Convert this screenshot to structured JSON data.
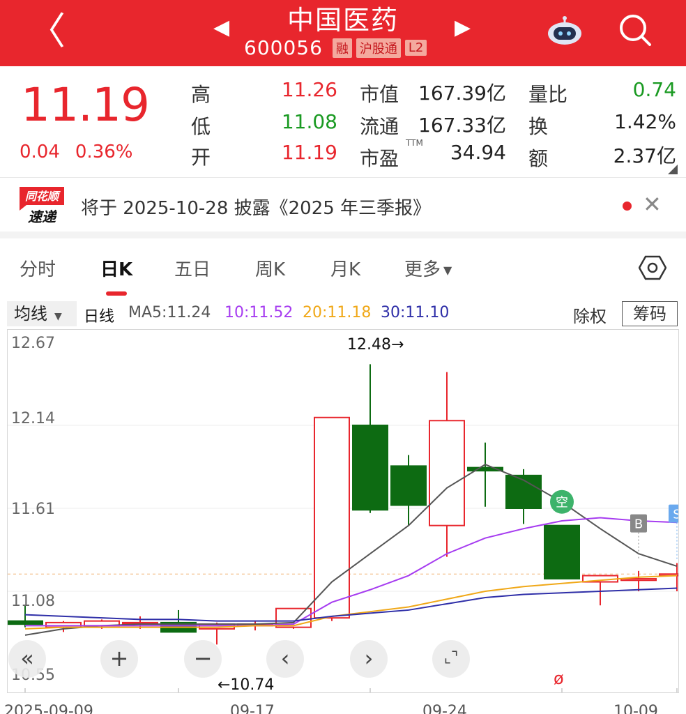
{
  "header": {
    "stock_name": "中国医药",
    "stock_code": "600056",
    "tags": [
      "融",
      "沪股通",
      "L2"
    ]
  },
  "quote": {
    "price": "11.19",
    "change": "0.04",
    "change_pct": "0.36%",
    "high_label": "高",
    "high": "11.26",
    "low_label": "低",
    "low": "11.08",
    "open_label": "开",
    "open": "11.19",
    "mktcap_label": "市值",
    "mktcap": "167.39亿",
    "float_label": "流通",
    "float": "167.33亿",
    "pe_label": "市盈",
    "pe_sup": "TTM",
    "pe": "34.94",
    "volratio_label": "量比",
    "volratio": "0.74",
    "turnover_label": "换",
    "turnover": "1.42%",
    "amount_label": "额",
    "amount": "2.37亿"
  },
  "notice": {
    "logo_top": "同花顺",
    "logo_bottom": "速递",
    "text": "将于 2025-10-28 披露《2025 年三季报》"
  },
  "tabs": [
    "分时",
    "日K",
    "五日",
    "周K",
    "月K",
    "更多"
  ],
  "active_tab": 1,
  "ma": {
    "select": "均线",
    "kind": "日线",
    "ma5": "MA5:11.24",
    "ma10": "10:11.52",
    "ma20": "20:11.18",
    "ma30": "30:11.10",
    "chuquan": "除权",
    "chouma": "筹码"
  },
  "colors": {
    "brand": "#e8262d",
    "up": "#e8262d",
    "down": "#0d6b12",
    "ma5": "#555555",
    "ma10": "#a63cf0",
    "ma20": "#f0a818",
    "ma30": "#2f2fa8"
  },
  "chart_data": {
    "type": "candlestick",
    "y_ticks": [
      "12.67",
      "12.14",
      "11.61",
      "11.08",
      "10.55"
    ],
    "ylim": [
      10.55,
      12.67
    ],
    "x_labels": [
      "2025-09-09",
      "09-17",
      "09-24",
      "10-09"
    ],
    "annotations": {
      "max_label": "12.48→",
      "min_label": "←10.74"
    },
    "markers": {
      "kong": "空",
      "buy": "B",
      "sell": "S",
      "cut": "ø"
    },
    "candles": [
      {
        "open": 10.89,
        "close": 10.87,
        "high": 10.99,
        "low": 10.85
      },
      {
        "open": 10.85,
        "close": 10.88,
        "high": 10.89,
        "low": 10.82
      },
      {
        "open": 10.86,
        "close": 10.89,
        "high": 10.9,
        "low": 10.84
      },
      {
        "open": 10.88,
        "close": 10.88,
        "high": 10.92,
        "low": 10.84
      },
      {
        "open": 10.88,
        "close": 10.82,
        "high": 10.96,
        "low": 10.82
      },
      {
        "open": 10.84,
        "close": 10.87,
        "high": 10.88,
        "low": 10.74
      },
      {
        "open": 10.86,
        "close": 10.87,
        "high": 10.89,
        "low": 10.83
      },
      {
        "open": 10.85,
        "close": 10.97,
        "high": 10.97,
        "low": 10.84
      },
      {
        "open": 10.91,
        "close": 12.19,
        "high": 12.19,
        "low": 10.89
      },
      {
        "open": 12.14,
        "close": 11.6,
        "high": 12.53,
        "low": 11.58
      },
      {
        "open": 11.88,
        "close": 11.63,
        "high": 11.95,
        "low": 11.5
      },
      {
        "open": 11.5,
        "close": 12.17,
        "high": 12.48,
        "low": 11.3
      },
      {
        "open": 11.87,
        "close": 11.85,
        "high": 12.03,
        "low": 11.62
      },
      {
        "open": 11.82,
        "close": 11.61,
        "high": 11.86,
        "low": 11.51
      },
      {
        "open": 11.5,
        "close": 11.16,
        "high": 11.5,
        "low": 11.16
      },
      {
        "open": 11.14,
        "close": 11.18,
        "high": 11.18,
        "low": 10.99
      },
      {
        "open": 11.15,
        "close": 11.16,
        "high": 11.21,
        "low": 11.08
      },
      {
        "open": 11.18,
        "close": 11.19,
        "high": 11.26,
        "low": 11.08
      }
    ],
    "ma5": [
      10.8,
      10.84,
      10.86,
      10.87,
      10.87,
      10.87,
      10.87,
      10.88,
      11.14,
      11.32,
      11.5,
      11.74,
      11.89,
      11.79,
      11.65,
      11.48,
      11.32,
      11.24
    ],
    "ma10": [
      10.86,
      10.86,
      10.86,
      10.86,
      10.86,
      10.86,
      10.86,
      10.87,
      11.01,
      11.09,
      11.18,
      11.32,
      11.42,
      11.48,
      11.53,
      11.55,
      11.53,
      11.52
    ],
    "ma20": [
      10.84,
      10.85,
      10.85,
      10.85,
      10.85,
      10.85,
      10.86,
      10.86,
      10.92,
      10.95,
      10.98,
      11.03,
      11.08,
      11.11,
      11.13,
      11.15,
      11.17,
      11.18
    ],
    "ma30": [
      10.93,
      10.92,
      10.91,
      10.9,
      10.9,
      10.89,
      10.89,
      10.89,
      10.92,
      10.94,
      10.96,
      11.0,
      11.04,
      11.06,
      11.07,
      11.08,
      11.09,
      11.1
    ]
  },
  "controls": [
    "«",
    "+",
    "−",
    "‹",
    "›",
    "⌞⌝"
  ]
}
